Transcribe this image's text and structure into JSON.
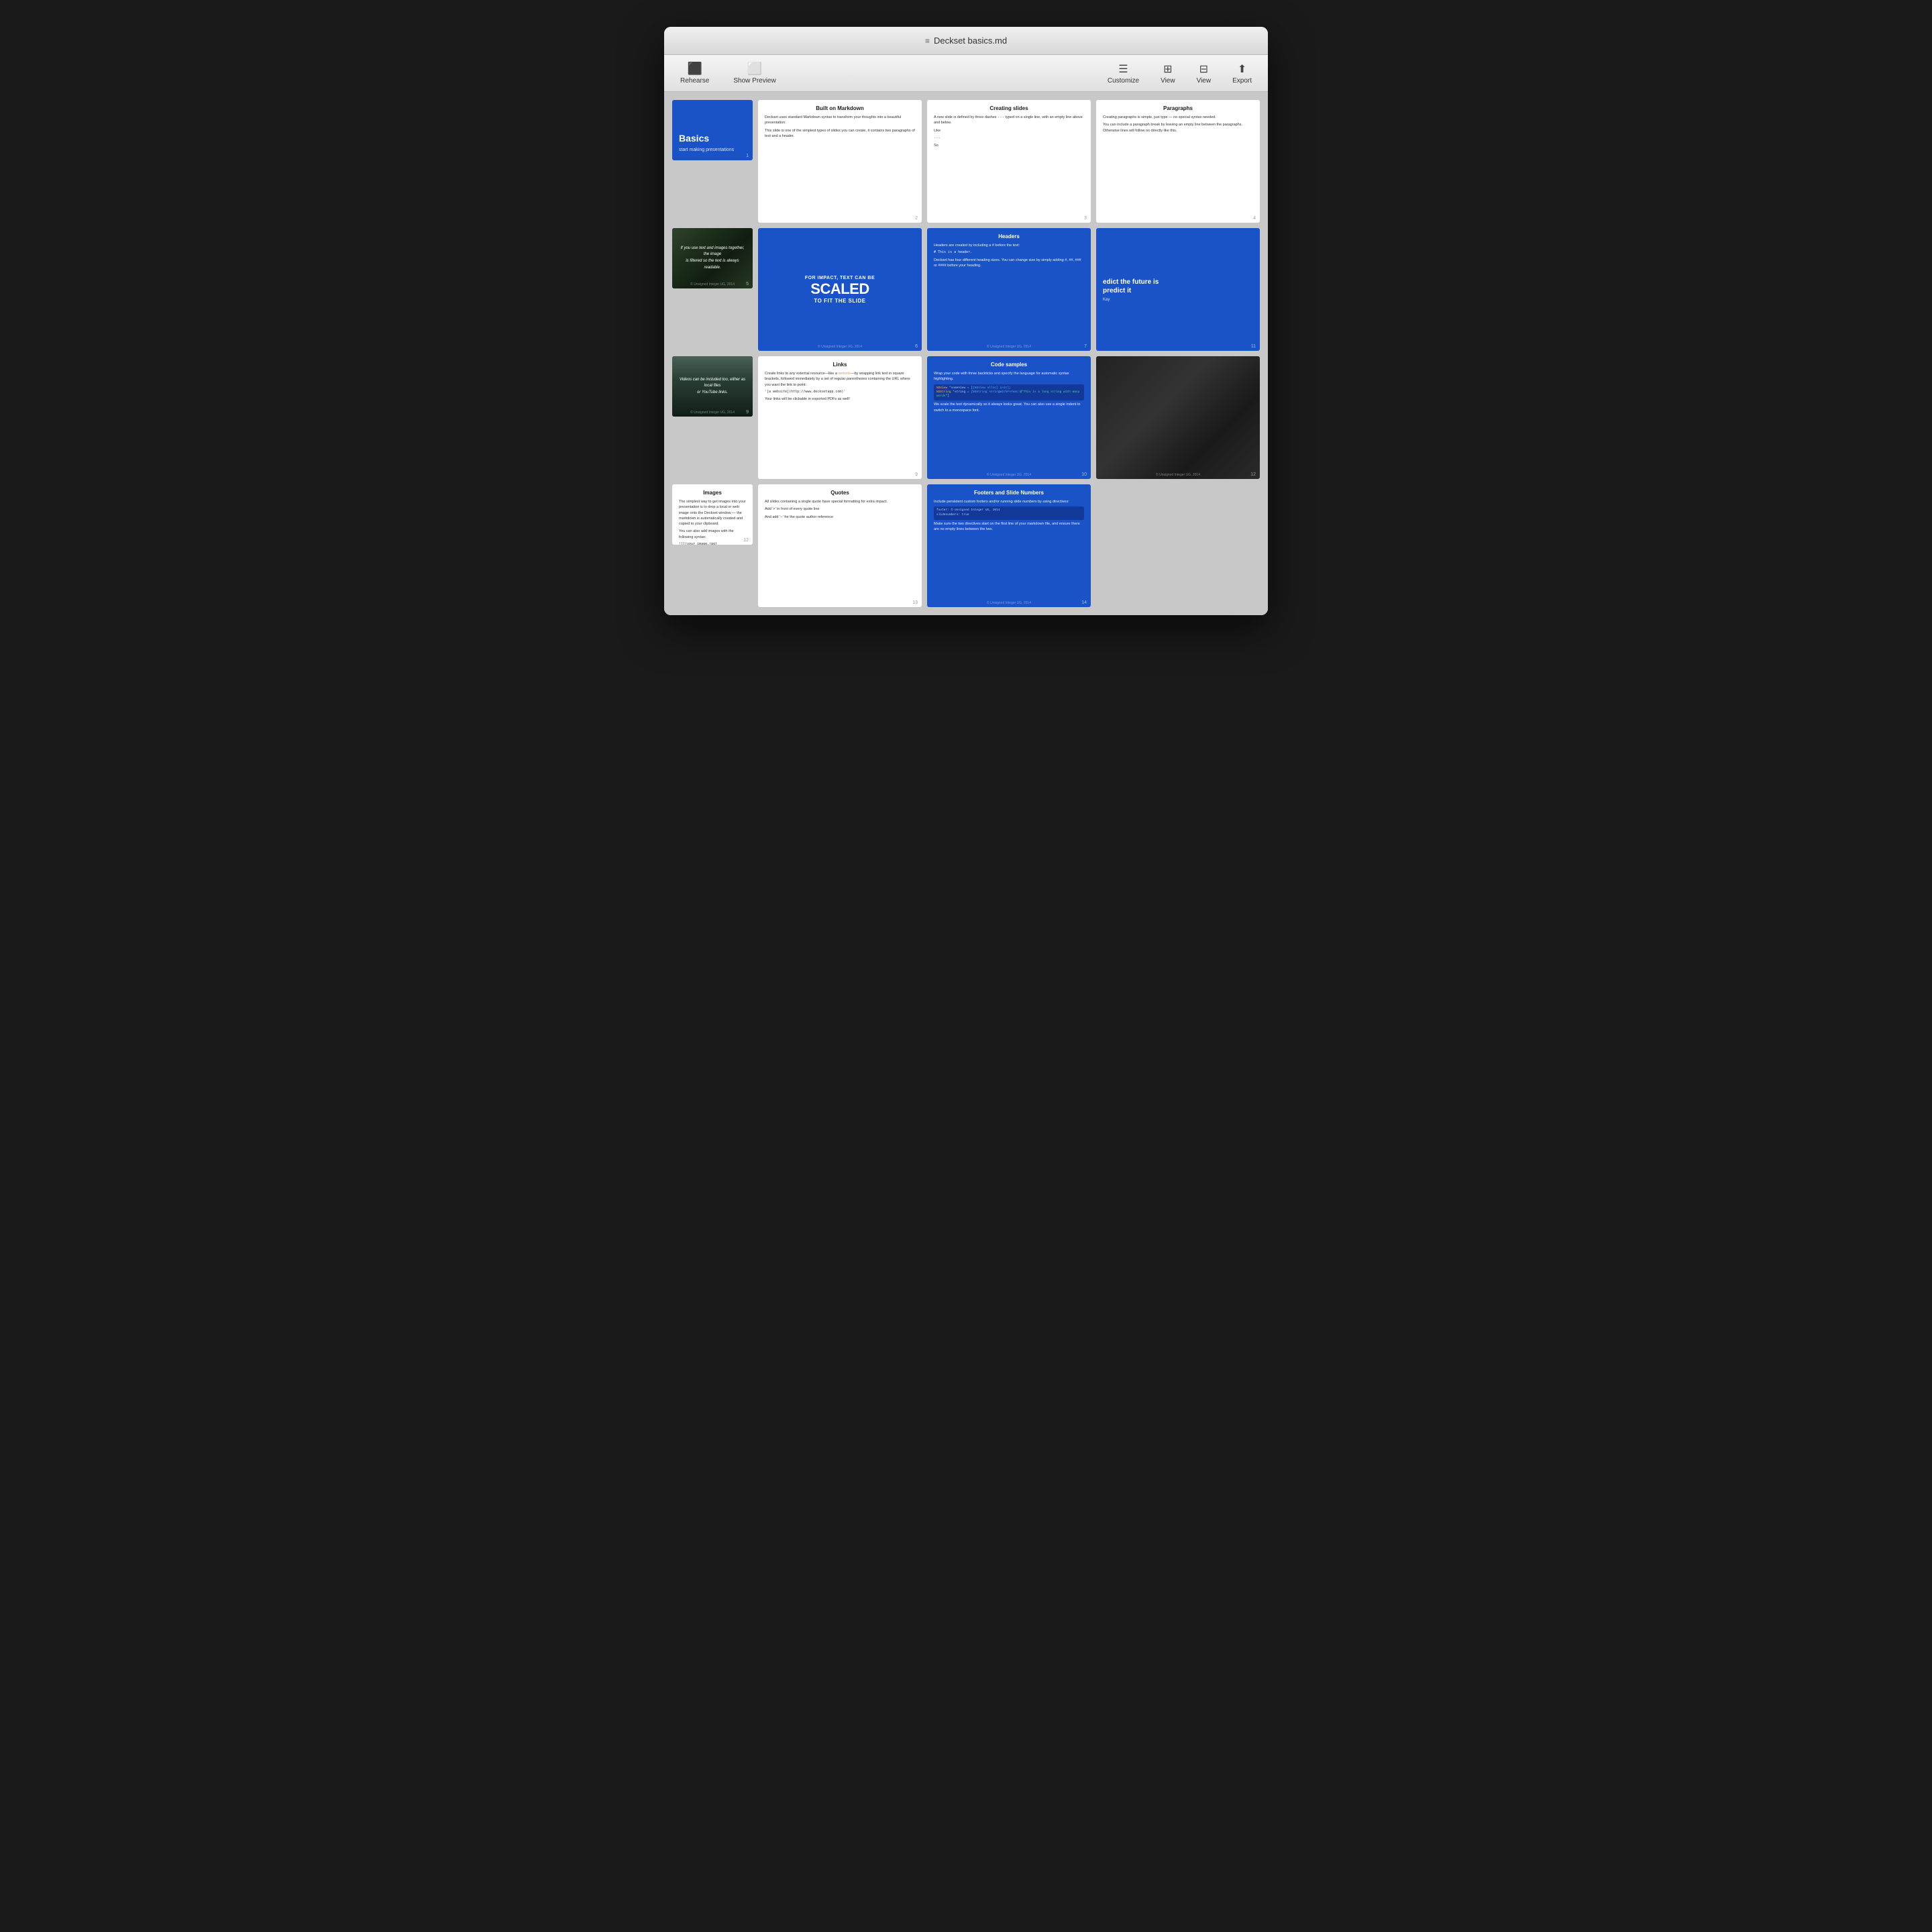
{
  "window": {
    "title": "Deckset basics.md",
    "icon": "≡"
  },
  "toolbar": {
    "rehearse_label": "Rehearse",
    "show_preview_label": "Show Preview",
    "customize_label": "Customize",
    "view_label": "View",
    "export_label": "Export"
  },
  "slides": [
    {
      "id": 1,
      "type": "basics",
      "title": "Basics",
      "subtitle": "start making presentations",
      "number": "1"
    },
    {
      "id": 2,
      "type": "white",
      "title": "Built on Markdown",
      "body": [
        "Deckset uses standard Markdown syntax to transform your thoughts into a beautiful presentation.",
        "This slide is one of the simplest types of slides you can create, it contains two paragraphs of text and a header."
      ],
      "number": "2"
    },
    {
      "id": 3,
      "type": "white",
      "title": "Creating slides",
      "body": [
        "A new slide is defined by three dashes `---` typed on a single line, with an empty line above and below.",
        "Like",
        "---",
        "So"
      ],
      "number": "3"
    },
    {
      "id": 4,
      "type": "white",
      "title": "Paragraphs",
      "body": [
        "Creating paragraphs is simple, just type — no special syntax needed.",
        "You can include a paragraph break by leaving an empty line between the paragraphs. Otherwise lines will follow on directly like this."
      ],
      "number": "4"
    },
    {
      "id": 5,
      "type": "photo-text",
      "photo_type": "mountain",
      "text": "If you use text and images together, the image is filtered so the text is always readable.",
      "number": "5"
    },
    {
      "id": 6,
      "type": "scaled",
      "line1": "FOR IMPACT, TEXT CAN BE",
      "line2": "SCALED",
      "line3": "TO FIT THE SLIDE",
      "number": "6"
    },
    {
      "id": 7,
      "type": "blue",
      "title": "Headers",
      "body": [
        "Headers are created by including a # before the text:",
        "# This is a header.",
        "Deckset has four different heading sizes. You can change size by simply adding #, ##, ### or #### before your heading."
      ],
      "number": "7"
    },
    {
      "id": 8,
      "type": "photo-text",
      "photo_type": "video",
      "text": "Videos can be included too, either as local files or YouTube links.",
      "number": "8"
    },
    {
      "id": 9,
      "type": "white",
      "title": "Links",
      "body": [
        "Create links to any external resource—like a website—by wrapping link text in square brackets, followed immediately by a set of regular parentheses containing the URL where you want the link to point:",
        "'[a website](http://www.decksetapp.com)'",
        "Your links will be clickable in exported PDFs as well!"
      ],
      "number": "9",
      "has_link": true
    },
    {
      "id": 10,
      "type": "blue",
      "title": "Code samples",
      "body": [
        "Wrap your code with three backticks and specify the language for automatic syntax highlighting.",
        "We scale the text dynamically so it always looks great. You can also use a single indent to switch to a monospace font."
      ],
      "code": "NSView *someView = [[NSView alloc] init];\nNSString *string = [NSString stringWithFormat:@\"This is a long string with many words\"]",
      "number": "10"
    },
    {
      "id": 11,
      "type": "predict",
      "title": "edict the future is\npredict it",
      "author": "Kay",
      "number": "11"
    },
    {
      "id": 12,
      "type": "white",
      "title": "Images",
      "body": [
        "The simplest way to get images into your presentation is to drop a local or web image onto the Deckset window — the markdown is automatically created and copied to your clipboard.",
        "You can also add images with the following syntax:",
        "![](your_image.jpg)"
      ],
      "number": "12"
    },
    {
      "id": 13,
      "type": "white",
      "title": "Quotes",
      "body": [
        "All slides containing a single quote have special formatting for extra impact.",
        "Add '>' in front of every quote line",
        "And add '--' for the quote author reference"
      ],
      "number": "13"
    },
    {
      "id": 14,
      "type": "blue",
      "title": "Footers and Slide Numbers",
      "body": [
        "Include persistent custom footers and/or running slide numbers by using directives:",
        "footer: © Unsigned Integer UG, 2014\nslidenumbers: true",
        "Make sure the two directives start on the first line of your markdown file, and ensure there are no empty lines between the two."
      ],
      "number": "14",
      "has_code": true
    }
  ],
  "watermark": "© Unsigned Integer UG, 2014"
}
